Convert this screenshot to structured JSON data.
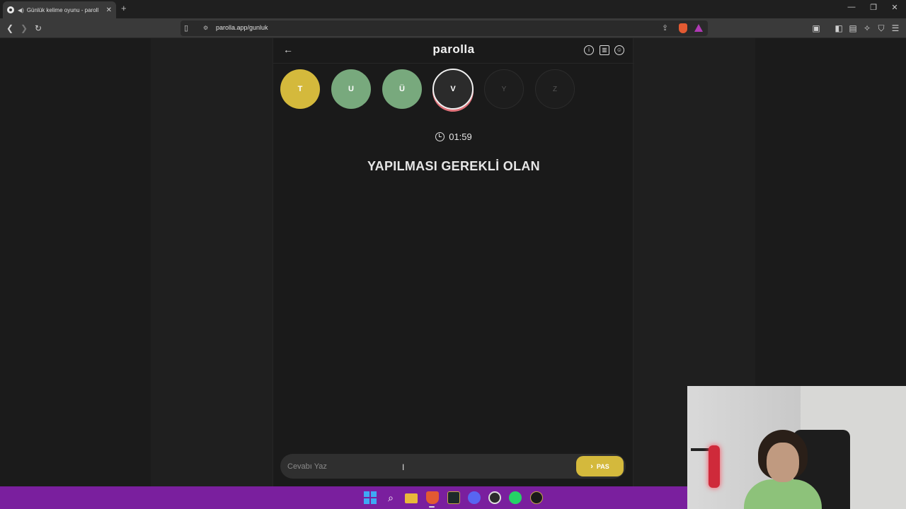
{
  "browser": {
    "tab_title": "Günlük kelime oyunu - paroll",
    "url": "parolla.app/gunluk"
  },
  "app": {
    "logo": "parolla",
    "letters": [
      {
        "letter": "T",
        "state": "yellow"
      },
      {
        "letter": "U",
        "state": "green"
      },
      {
        "letter": "Ü",
        "state": "green"
      },
      {
        "letter": "V",
        "state": "active"
      },
      {
        "letter": "Y",
        "state": "empty"
      },
      {
        "letter": "Z",
        "state": "empty"
      }
    ],
    "timer": "01:59",
    "question": "YAPILMASI GEREKLİ OLAN",
    "answer_placeholder": "Cevabı Yaz",
    "pass_label": "PAS"
  },
  "colors": {
    "yellow": "#d4b93c",
    "green": "#78a97d",
    "active_ring": "#e0727a",
    "taskbar": "#7a1f9e"
  }
}
